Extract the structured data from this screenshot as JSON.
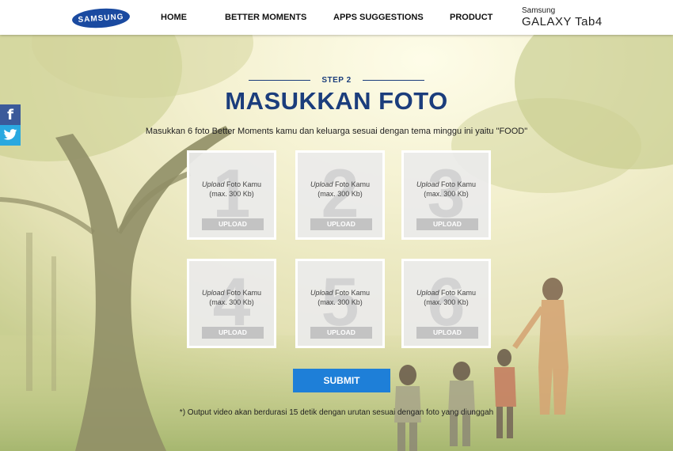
{
  "header": {
    "logo": "SAMSUNG",
    "nav": [
      "HOME",
      "BETTER MOMENTS",
      "APPS SUGGESTIONS",
      "PRODUCT"
    ],
    "brand_small": "Samsung",
    "brand_big": "GALAXY Tab4"
  },
  "social": {
    "facebook": "f",
    "twitter": "t"
  },
  "step": {
    "label": "STEP 2",
    "title": "MASUKKAN FOTO",
    "instruction": "Masukkan 6 foto Better Moments kamu dan keluarga sesuai dengan tema minggu ini yaitu \"FOOD\""
  },
  "slots": [
    {
      "number": "1",
      "label_italic": "Upload",
      "label_rest": " Foto Kamu",
      "limit": "(max. 300 Kb)",
      "button": "UPLOAD"
    },
    {
      "number": "2",
      "label_italic": "Upload",
      "label_rest": " Foto Kamu",
      "limit": "(max. 300 Kb)",
      "button": "UPLOAD"
    },
    {
      "number": "3",
      "label_italic": "Upload",
      "label_rest": " Foto Kamu",
      "limit": "(max. 300 Kb)",
      "button": "UPLOAD"
    },
    {
      "number": "4",
      "label_italic": "Upload",
      "label_rest": " Foto Kamu",
      "limit": "(max. 300 Kb)",
      "button": "UPLOAD"
    },
    {
      "number": "5",
      "label_italic": "Upload",
      "label_rest": " Foto Kamu",
      "limit": "(max. 300 Kb)",
      "button": "UPLOAD"
    },
    {
      "number": "6",
      "label_italic": "Upload",
      "label_rest": " Foto Kamu",
      "limit": "(max. 300 Kb)",
      "button": "UPLOAD"
    }
  ],
  "submit": "SUBMIT",
  "note": "*) Output video akan berdurasi 15 detik dengan urutan sesuai dengan foto yang diunggah",
  "colors": {
    "title": "#1b3d7c",
    "submit": "#1e7fd8",
    "facebook": "#3b5a9a",
    "twitter": "#2aa8e0"
  }
}
